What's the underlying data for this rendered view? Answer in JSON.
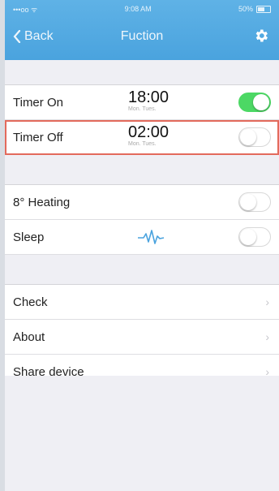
{
  "status_bar": {
    "carrier": "•••oo ᯤ",
    "time": "9:08 AM",
    "battery": "50%"
  },
  "nav": {
    "back_label": "Back",
    "title": "Fuction"
  },
  "timer_section": [
    {
      "label": "Timer On",
      "time": "18:00",
      "days": "Mon. Tues.",
      "on": true
    },
    {
      "label": "Timer Off",
      "time": "02:00",
      "days": "Mon. Tues.",
      "on": false
    }
  ],
  "mode_section": [
    {
      "label": "8° Heating",
      "on": false
    },
    {
      "label": "Sleep",
      "on": false
    }
  ],
  "menu_section": [
    {
      "label": "Check"
    },
    {
      "label": "About"
    },
    {
      "label": "Share device"
    }
  ],
  "colors": {
    "accent": "#4aa3de",
    "toggle_on": "#4cd864",
    "highlight": "#e36a5c"
  }
}
